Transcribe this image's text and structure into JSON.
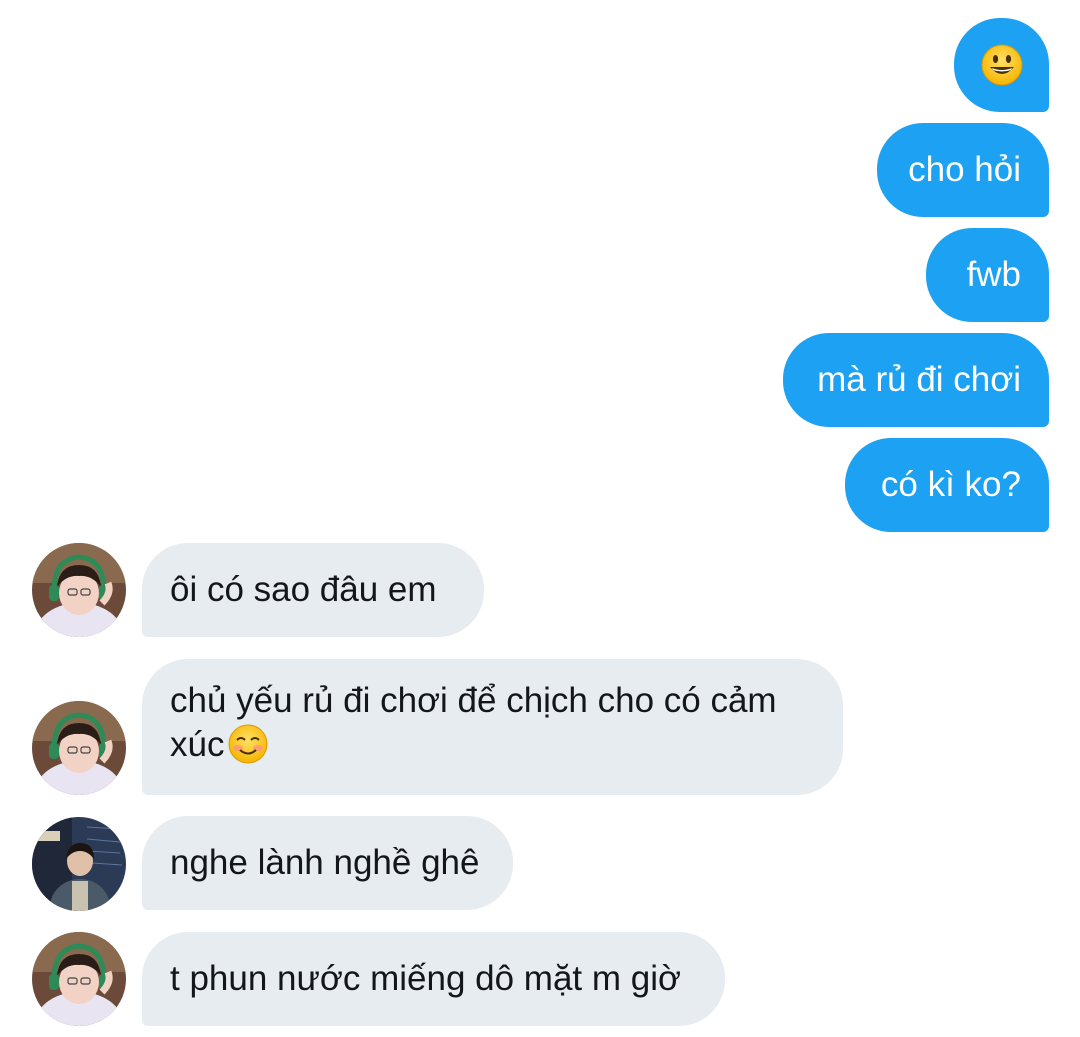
{
  "messages": [
    {
      "side": "sent",
      "text": "",
      "emoji": "grinning-face-emoji"
    },
    {
      "side": "sent",
      "text": "cho hỏi"
    },
    {
      "side": "sent",
      "text": "fwb"
    },
    {
      "side": "sent",
      "text": "mà rủ đi chơi"
    },
    {
      "side": "sent",
      "text": "có kì ko?"
    },
    {
      "side": "received",
      "avatar": "avatar-headphones",
      "text": "ôi có sao đâu em"
    },
    {
      "side": "received",
      "avatar": "avatar-headphones",
      "text": "chủ yếu rủ đi chơi để chịch cho có cảm xúc",
      "emoji": "smiling-face-emoji"
    },
    {
      "side": "received",
      "avatar": "avatar-jacket",
      "text": "nghe lành nghề ghê"
    },
    {
      "side": "received",
      "avatar": "avatar-headphones",
      "text": "t phun nước miếng dô mặt m giờ"
    }
  ],
  "colors": {
    "sent_bubble": "#1da1f2",
    "received_bubble": "#e6ecf0",
    "sent_text": "#ffffff",
    "received_text": "#14171a"
  }
}
